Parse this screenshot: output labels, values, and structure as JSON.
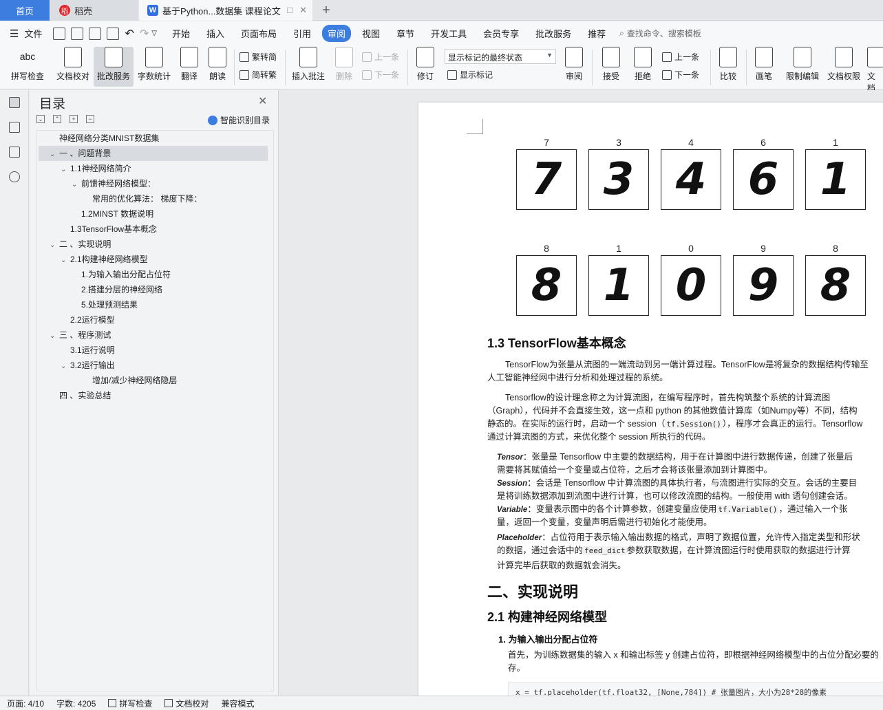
{
  "tabs": {
    "home": "首页",
    "daoke": "稻壳",
    "doc": "基于Python...数据集 课程论文",
    "daoke_icon": "daoke-logo-icon",
    "doc_icon": "wps-writer-icon"
  },
  "menu": {
    "file": "文件",
    "items": [
      "开始",
      "插入",
      "页面布局",
      "引用",
      "审阅",
      "视图",
      "章节",
      "开发工具",
      "会员专享",
      "批改服务",
      "推荐"
    ],
    "active_index": 4,
    "search_placeholder": "查找命令、搜索模板"
  },
  "ribbon": {
    "spell": "拼写检查",
    "doc_check": "文档校对",
    "review_service": "批改服务",
    "word_count": "字数统计",
    "translate": "翻译",
    "read": "朗读",
    "trad2simp": "繁转简",
    "simp2trad": "简转繁",
    "insert_comment": "插入批注",
    "delete": "删除",
    "prev_comment": "上一条",
    "next_comment": "下一条",
    "revise": "修订",
    "markup_state": "显示标记的最终状态",
    "show_markup": "显示标记",
    "review": "审阅",
    "accept": "接受",
    "reject": "拒绝",
    "prev_change": "上一条",
    "next_change": "下一条",
    "compare": "比较",
    "pen": "画笔",
    "restrict": "限制编辑",
    "doc_permission": "文档权限",
    "doc_more": "文档"
  },
  "toc": {
    "title": "目录",
    "smart": "智能识别目录",
    "items": [
      {
        "text": "神经网络分类MNIST数据集",
        "level": 0,
        "chev": ""
      },
      {
        "text": "一 、问题背景",
        "level": 0,
        "chev": "v",
        "selected": true
      },
      {
        "text": "1.1神经网络简介",
        "level": 1,
        "chev": "v"
      },
      {
        "text": "前馈神经网络模型：",
        "level": 2,
        "chev": "v"
      },
      {
        "text": "常用的优化算法： 梯度下降：",
        "level": 3,
        "chev": ""
      },
      {
        "text": "1.2MINST 数据说明",
        "level": 2,
        "chev": ""
      },
      {
        "text": "1.3TensorFlow基本概念",
        "level": 1,
        "chev": ""
      },
      {
        "text": "二 、实现说明",
        "level": 0,
        "chev": "v"
      },
      {
        "text": "2.1构建神经网络模型",
        "level": 1,
        "chev": "v"
      },
      {
        "text": "1.为输入输出分配占位符",
        "level": 2,
        "chev": ""
      },
      {
        "text": "2.搭建分层的神经网络",
        "level": 2,
        "chev": ""
      },
      {
        "text": "5.处理预测结果",
        "level": 2,
        "chev": ""
      },
      {
        "text": "2.2运行模型",
        "level": 1,
        "chev": ""
      },
      {
        "text": "三 、程序测试",
        "level": 0,
        "chev": "v"
      },
      {
        "text": "3.1运行说明",
        "level": 1,
        "chev": ""
      },
      {
        "text": "3.2运行输出",
        "level": 1,
        "chev": "v"
      },
      {
        "text": "增加/减少神经网络隐层",
        "level": 3,
        "chev": ""
      },
      {
        "text": "四 、实验总结",
        "level": 0,
        "chev": ""
      }
    ]
  },
  "doc": {
    "digits_row1": [
      {
        "label": "7",
        "glyph": "7"
      },
      {
        "label": "3",
        "glyph": "3"
      },
      {
        "label": "4",
        "glyph": "4"
      },
      {
        "label": "6",
        "glyph": "6"
      },
      {
        "label": "1",
        "glyph": "1"
      }
    ],
    "digits_row2": [
      {
        "label": "8",
        "glyph": "8"
      },
      {
        "label": "1",
        "glyph": "1"
      },
      {
        "label": "0",
        "glyph": "0"
      },
      {
        "label": "9",
        "glyph": "9"
      },
      {
        "label": "8",
        "glyph": "8"
      }
    ],
    "h13": "1.3 TensorFlow基本概念",
    "p1a": "TensorFlow为张量从流图的一端流动到另一端计算过程。TensorFlow是将复杂的数据结构传输至",
    "p1b": "人工智能神经网中进行分析和处理过程的系统。",
    "p2a": "Tensorflow的设计理念称之为计算流图，在编写程序时，首先构筑整个系统的计算流图",
    "p2b": "（Graph），代码并不会直接生效，这一点和 python 的其他数值计算库（如Numpy等）不同，结构",
    "p2c_pre": "静态的。在实际的运行时，启动一个 session（",
    "p2c_code": "tf.Session()",
    "p2c_post": "），程序才会真正的运行。Tensorflow",
    "p2d": "通过计算流图的方式，来优化整个 session 所执行的代码。",
    "b1_term": "Tensor",
    "b1a": "：张量是 Tensorflow 中主要的数据结构，用于在计算图中进行数据传递，创建了张量后",
    "b1b": "需要将其赋值给一个变量或占位符，之后才会将该张量添加到计算图中。",
    "b2_term": "Session",
    "b2a": "：会话是 Tensorflow 中计算流图的具体执行者，与流图进行实际的交互。会话的主要目",
    "b2b": "是将训练数据添加到流图中进行计算，也可以修改流图的结构。一般使用 with 语句创建会话。",
    "b3_term": "Variable",
    "b3a_pre": "：变量表示图中的各个计算参数，创建变量应使用",
    "b3a_code": "tf.Variable()",
    "b3a_post": "，通过输入一个张",
    "b3b": "量，返回一个变量，变量声明后需进行初始化才能使用。",
    "b4_term": "Placeholder",
    "b4a": "：占位符用于表示输入输出数据的格式，声明了数据位置，允许传入指定类型和形状",
    "b4b_pre": "的数据，通过会话中的",
    "b4b_code": "feed_dict",
    "b4b_post": "参数获取数据，在计算流图运行时使用获取的数据进行计算",
    "b4c": "计算完毕后获取的数据就会消失。",
    "h2": "二、实现说明",
    "h21": "2.1 构建神经网络模型",
    "h211": "1. 为输入输出分配占位符",
    "p3a": "首先，为训练数据集的输入 x 和输出标签 y 创建占位符，即根据神经网络模型中的占位分配必要的",
    "p3b": "存。",
    "code": "x = tf.placeholder(tf.float32, [None,784]) # 张量图片，大小为28*28的像素"
  },
  "status": {
    "page": "页面: 4/10",
    "words": "字数: 4205",
    "spell": "拼写检查",
    "doc_check": "文档校对",
    "compat": "兼容模式"
  }
}
